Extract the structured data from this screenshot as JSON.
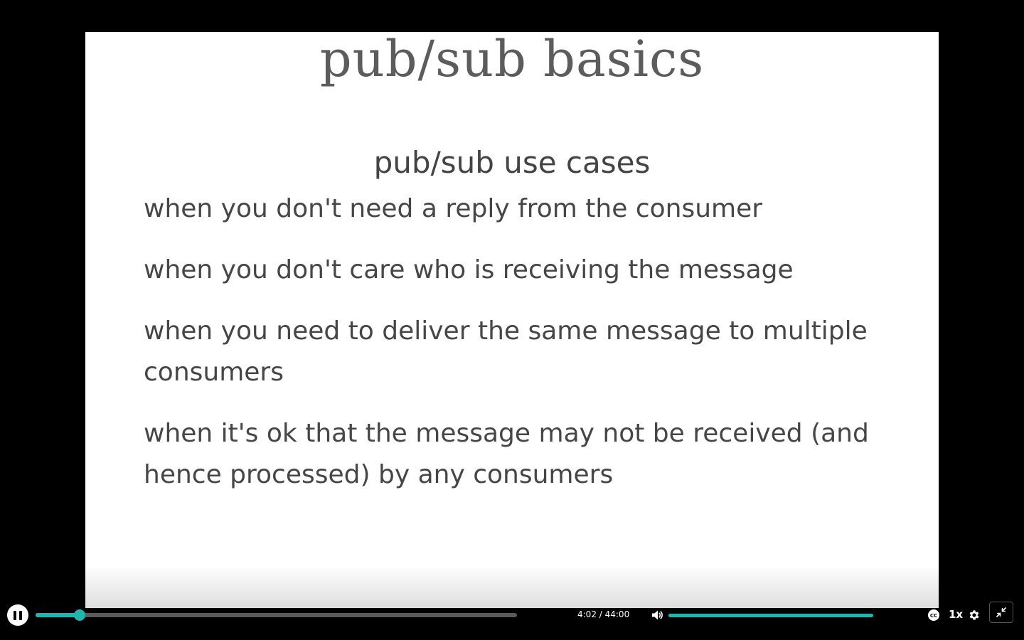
{
  "slide": {
    "title": "pub/sub basics",
    "subtitle": "pub/sub use cases",
    "bullets": [
      "when you don't need a reply from the consumer",
      "when you don't care who is receiving the message",
      "when you need to deliver the same message to multiple consumers",
      "when it's ok that the message may not be received (and hence processed) by any consumers"
    ]
  },
  "controls": {
    "pause_icon": "pause-icon",
    "progress_fraction": 0.0917,
    "time_display": "4:02 / 44:00",
    "volume_icon": "volume-icon",
    "volume_fraction": 1.0,
    "cc_icon": "closed-captions-icon",
    "speed_label": "1x",
    "settings_icon": "gear-icon",
    "fullscreen_icon": "exit-fullscreen-icon",
    "accent_color": "#1fb5b0"
  }
}
